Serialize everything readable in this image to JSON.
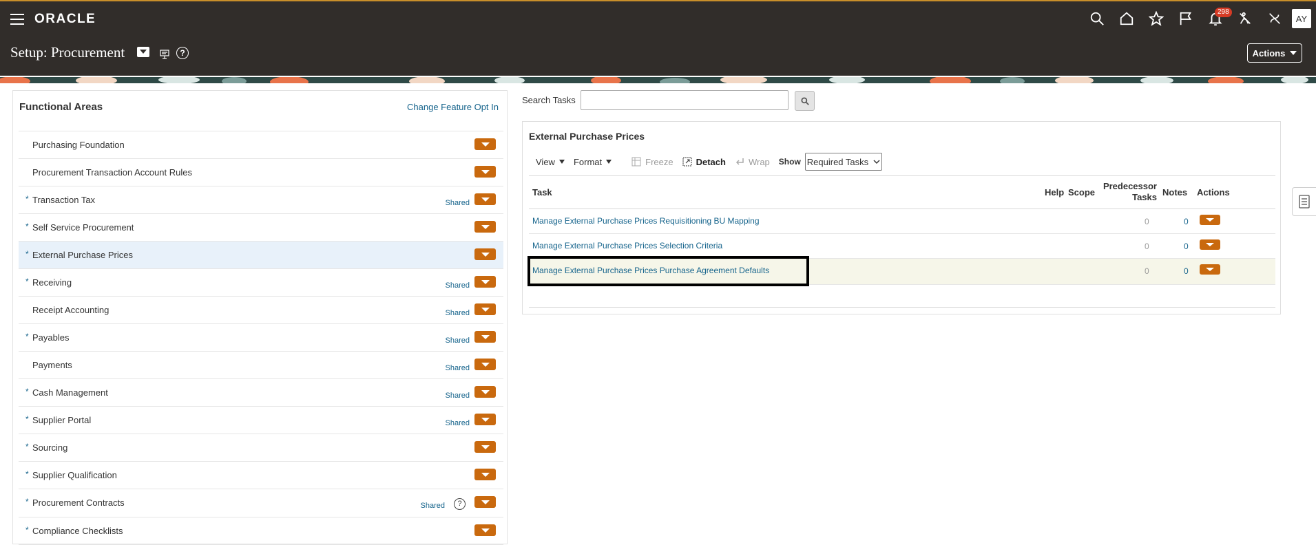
{
  "header": {
    "logo": "ORACLE",
    "notifications_count": "298",
    "avatar_initials": "AY",
    "page_title": "Setup: Procurement",
    "actions_label": "Actions"
  },
  "functional_areas": {
    "title": "Functional Areas",
    "change_link": "Change Feature Opt In",
    "items": [
      {
        "name": "Purchasing Foundation",
        "required": false,
        "shared": ""
      },
      {
        "name": "Procurement Transaction Account Rules",
        "required": false,
        "shared": ""
      },
      {
        "name": "Transaction Tax",
        "required": true,
        "shared": "Shared"
      },
      {
        "name": "Self Service Procurement",
        "required": true,
        "shared": ""
      },
      {
        "name": "External Purchase Prices",
        "required": true,
        "shared": "",
        "selected": true
      },
      {
        "name": "Receiving",
        "required": true,
        "shared": "Shared"
      },
      {
        "name": "Receipt Accounting",
        "required": false,
        "shared": "Shared"
      },
      {
        "name": "Payables",
        "required": true,
        "shared": "Shared"
      },
      {
        "name": "Payments",
        "required": false,
        "shared": "Shared"
      },
      {
        "name": "Cash Management",
        "required": true,
        "shared": "Shared"
      },
      {
        "name": "Supplier Portal",
        "required": true,
        "shared": "Shared"
      },
      {
        "name": "Sourcing",
        "required": true,
        "shared": ""
      },
      {
        "name": "Supplier Qualification",
        "required": true,
        "shared": ""
      },
      {
        "name": "Procurement Contracts",
        "required": true,
        "shared": "Shared",
        "help": true
      },
      {
        "name": "Compliance Checklists",
        "required": true,
        "shared": ""
      }
    ]
  },
  "search": {
    "label": "Search Tasks",
    "value": ""
  },
  "tasks_panel": {
    "title": "External Purchase Prices",
    "toolbar": {
      "view": "View",
      "format": "Format",
      "freeze": "Freeze",
      "detach": "Detach",
      "wrap": "Wrap",
      "show_label": "Show",
      "show_value": "Required Tasks"
    },
    "columns": {
      "task": "Task",
      "help": "Help",
      "scope": "Scope",
      "predecessor_line1": "Predecessor",
      "predecessor_line2": "Tasks",
      "notes": "Notes",
      "actions": "Actions"
    },
    "rows": [
      {
        "task": "Manage External Purchase Prices Requisitioning BU Mapping",
        "predecessor": "0",
        "notes": "0"
      },
      {
        "task": "Manage External Purchase Prices Selection Criteria",
        "predecessor": "0",
        "notes": "0"
      },
      {
        "task": "Manage External Purchase Prices Purchase Agreement Defaults",
        "predecessor": "0",
        "notes": "0"
      }
    ]
  },
  "colors": {
    "header_bg": "#312d2a",
    "accent": "#c9690e",
    "link": "#16648c",
    "selected_row": "#e8f1fa"
  }
}
